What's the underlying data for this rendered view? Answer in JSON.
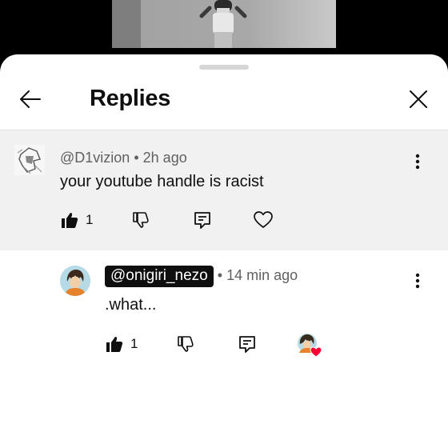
{
  "header": {
    "title": "Replies",
    "back_icon": "arrow-left-icon",
    "close_icon": "close-icon"
  },
  "parent_comment": {
    "author": "@D1vizion",
    "separator": "•",
    "time": "2h ago",
    "text": "your youtube handle is racist",
    "like_count": "1"
  },
  "reply": {
    "author": "@onigiri_nezo",
    "separator": "•",
    "time": "14 min ago",
    "text": ".what...",
    "like_count": "1",
    "creator_heart": "creator-heart-icon"
  },
  "colors": {
    "sheet_bg": "#ffffff",
    "parent_bg": "#f1f1f1",
    "text": "#0f0f0f",
    "meta": "#606060",
    "heart": "#ff0033",
    "chip_bg": "#0f0f0f"
  }
}
